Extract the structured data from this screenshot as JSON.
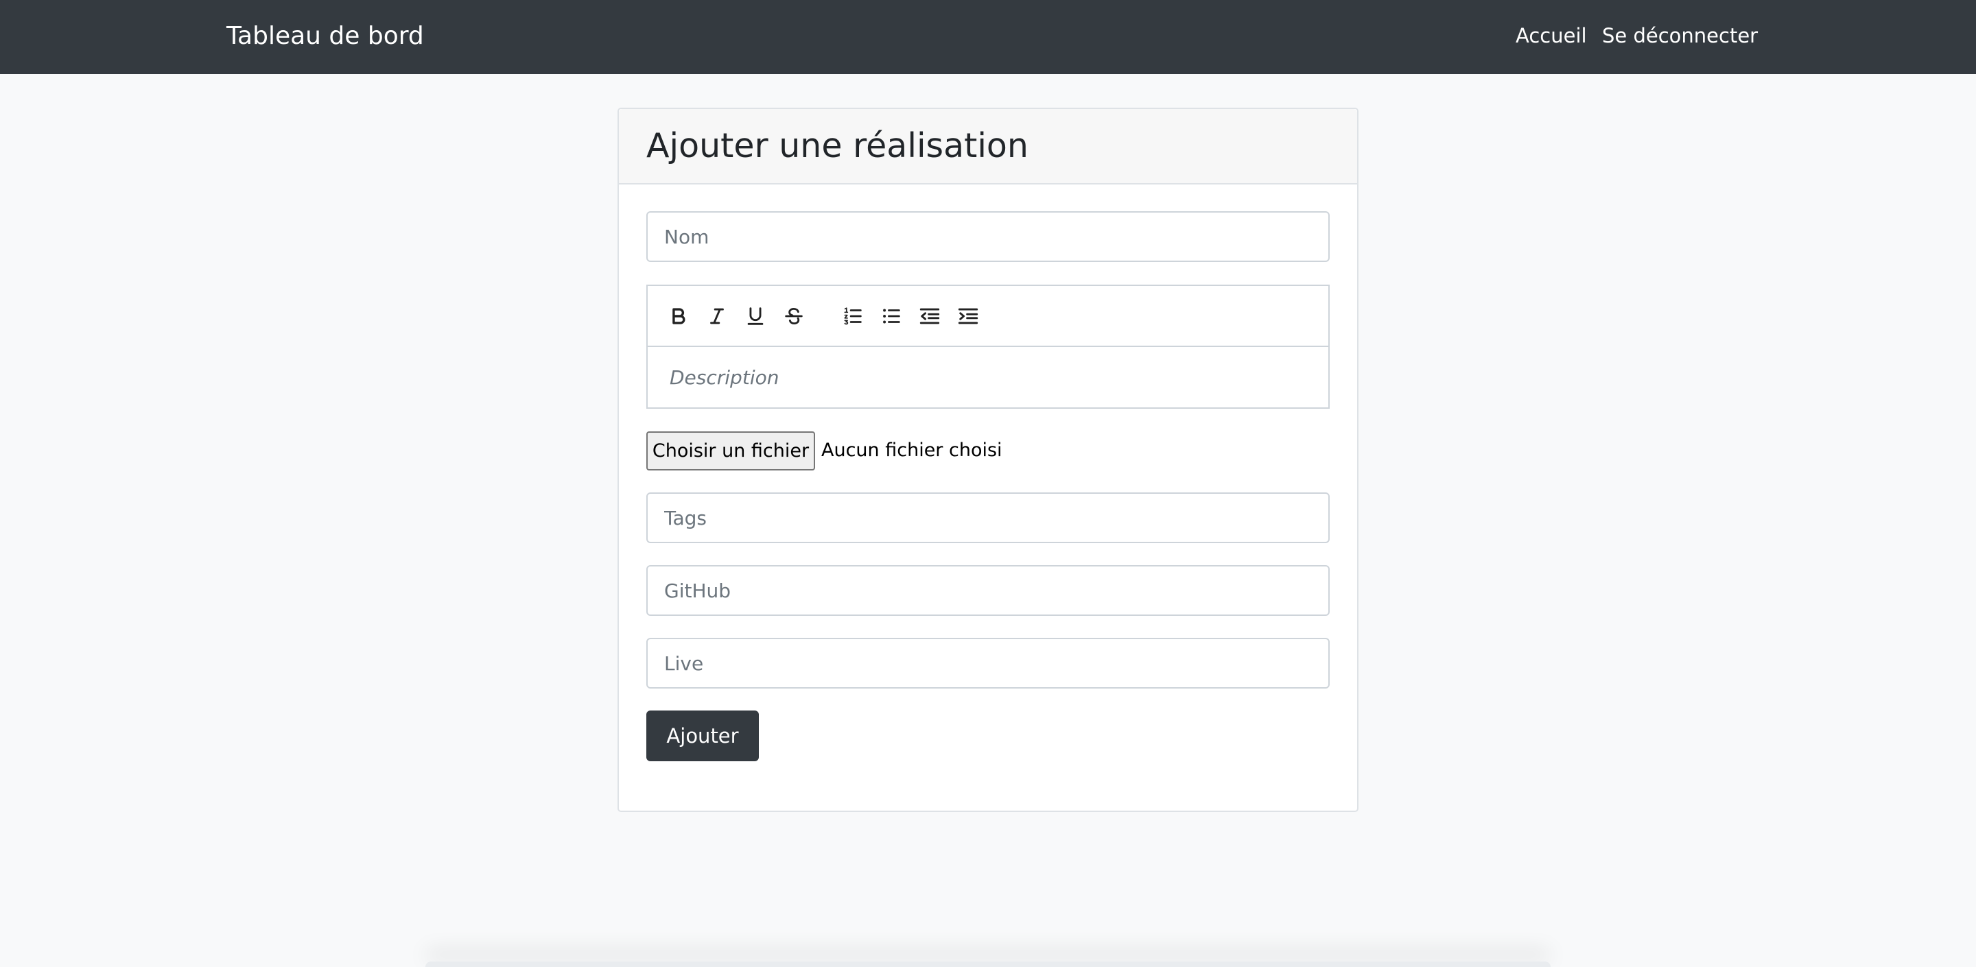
{
  "navbar": {
    "brand": "Tableau de bord",
    "links": [
      {
        "label": "Accueil"
      },
      {
        "label": "Se déconnecter"
      }
    ]
  },
  "form": {
    "title": "Ajouter une réalisation",
    "nom_placeholder": "Nom",
    "description_placeholder": "Description",
    "toolbar": [
      "bold-icon",
      "italic-icon",
      "underline-icon",
      "strikethrough-icon",
      "ordered-list-icon",
      "unordered-list-icon",
      "outdent-icon",
      "indent-icon"
    ],
    "file_button": "Choisir un fichier",
    "file_status": "Aucun fichier choisi",
    "tags_placeholder": "Tags",
    "github_placeholder": "GitHub",
    "live_placeholder": "Live",
    "submit_label": "Ajouter"
  },
  "colors": {
    "navbar_bg": "#343a40",
    "page_bg": "#f8f9fa",
    "button_bg": "#343a40"
  }
}
